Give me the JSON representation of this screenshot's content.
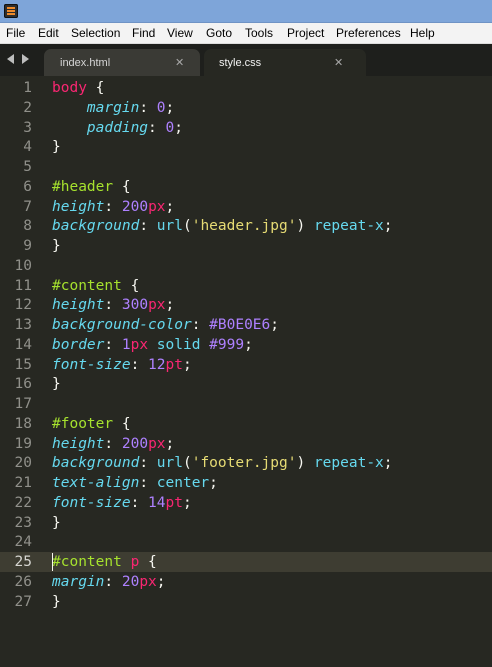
{
  "menu": [
    "File",
    "Edit",
    "Selection",
    "Find",
    "View",
    "Goto",
    "Tools",
    "Project",
    "Preferences",
    "Help"
  ],
  "tabs": [
    {
      "label": "index.html",
      "active": false
    },
    {
      "label": "style.css",
      "active": true
    }
  ],
  "current_line": 25,
  "lines": [
    [
      {
        "t": "body",
        "c": "sel"
      },
      {
        "t": " {",
        "c": "p"
      }
    ],
    [
      {
        "t": "    ",
        "c": "p"
      },
      {
        "t": "margin",
        "c": "prop"
      },
      {
        "t": ": ",
        "c": "p"
      },
      {
        "t": "0",
        "c": "num"
      },
      {
        "t": ";",
        "c": "p"
      }
    ],
    [
      {
        "t": "    ",
        "c": "p"
      },
      {
        "t": "padding",
        "c": "prop"
      },
      {
        "t": ": ",
        "c": "p"
      },
      {
        "t": "0",
        "c": "num"
      },
      {
        "t": ";",
        "c": "p"
      }
    ],
    [
      {
        "t": "}",
        "c": "p"
      }
    ],
    [],
    [
      {
        "t": "#header",
        "c": "id"
      },
      {
        "t": " {",
        "c": "p"
      }
    ],
    [
      {
        "t": "height",
        "c": "prop"
      },
      {
        "t": ": ",
        "c": "p"
      },
      {
        "t": "200",
        "c": "num"
      },
      {
        "t": "px",
        "c": "unit"
      },
      {
        "t": ";",
        "c": "p"
      }
    ],
    [
      {
        "t": "background",
        "c": "prop"
      },
      {
        "t": ": ",
        "c": "p"
      },
      {
        "t": "url",
        "c": "fn"
      },
      {
        "t": "(",
        "c": "p"
      },
      {
        "t": "'header.jpg'",
        "c": "str"
      },
      {
        "t": ") ",
        "c": "p"
      },
      {
        "t": "repeat-x",
        "c": "kw"
      },
      {
        "t": ";",
        "c": "p"
      }
    ],
    [
      {
        "t": "}",
        "c": "p"
      }
    ],
    [],
    [
      {
        "t": "#content",
        "c": "id"
      },
      {
        "t": " {",
        "c": "p"
      }
    ],
    [
      {
        "t": "height",
        "c": "prop"
      },
      {
        "t": ": ",
        "c": "p"
      },
      {
        "t": "300",
        "c": "num"
      },
      {
        "t": "px",
        "c": "unit"
      },
      {
        "t": ";",
        "c": "p"
      }
    ],
    [
      {
        "t": "background-color",
        "c": "prop"
      },
      {
        "t": ": ",
        "c": "p"
      },
      {
        "t": "#B0E0E6",
        "c": "num"
      },
      {
        "t": ";",
        "c": "p"
      }
    ],
    [
      {
        "t": "border",
        "c": "prop"
      },
      {
        "t": ": ",
        "c": "p"
      },
      {
        "t": "1",
        "c": "num"
      },
      {
        "t": "px",
        "c": "unit"
      },
      {
        "t": " solid ",
        "c": "kw"
      },
      {
        "t": "#999",
        "c": "num"
      },
      {
        "t": ";",
        "c": "p"
      }
    ],
    [
      {
        "t": "font-size",
        "c": "prop"
      },
      {
        "t": ": ",
        "c": "p"
      },
      {
        "t": "12",
        "c": "num"
      },
      {
        "t": "pt",
        "c": "unit"
      },
      {
        "t": ";",
        "c": "p"
      }
    ],
    [
      {
        "t": "}",
        "c": "p"
      }
    ],
    [],
    [
      {
        "t": "#footer",
        "c": "id"
      },
      {
        "t": " {",
        "c": "p"
      }
    ],
    [
      {
        "t": "height",
        "c": "prop"
      },
      {
        "t": ": ",
        "c": "p"
      },
      {
        "t": "200",
        "c": "num"
      },
      {
        "t": "px",
        "c": "unit"
      },
      {
        "t": ";",
        "c": "p"
      }
    ],
    [
      {
        "t": "background",
        "c": "prop"
      },
      {
        "t": ": ",
        "c": "p"
      },
      {
        "t": "url",
        "c": "fn"
      },
      {
        "t": "(",
        "c": "p"
      },
      {
        "t": "'footer.jpg'",
        "c": "str"
      },
      {
        "t": ") ",
        "c": "p"
      },
      {
        "t": "repeat-x",
        "c": "kw"
      },
      {
        "t": ";",
        "c": "p"
      }
    ],
    [
      {
        "t": "text-align",
        "c": "prop"
      },
      {
        "t": ": ",
        "c": "p"
      },
      {
        "t": "center",
        "c": "kw"
      },
      {
        "t": ";",
        "c": "p"
      }
    ],
    [
      {
        "t": "font-size",
        "c": "prop"
      },
      {
        "t": ": ",
        "c": "p"
      },
      {
        "t": "14",
        "c": "num"
      },
      {
        "t": "pt",
        "c": "unit"
      },
      {
        "t": ";",
        "c": "p"
      }
    ],
    [
      {
        "t": "}",
        "c": "p"
      }
    ],
    [],
    [
      {
        "t": "#content",
        "c": "id"
      },
      {
        "t": " ",
        "c": "p"
      },
      {
        "t": "p",
        "c": "sel"
      },
      {
        "t": " {",
        "c": "p"
      }
    ],
    [
      {
        "t": "margin",
        "c": "prop"
      },
      {
        "t": ": ",
        "c": "p"
      },
      {
        "t": "20",
        "c": "num"
      },
      {
        "t": "px",
        "c": "unit"
      },
      {
        "t": ";",
        "c": "p"
      }
    ],
    [
      {
        "t": "}",
        "c": "p"
      }
    ]
  ]
}
